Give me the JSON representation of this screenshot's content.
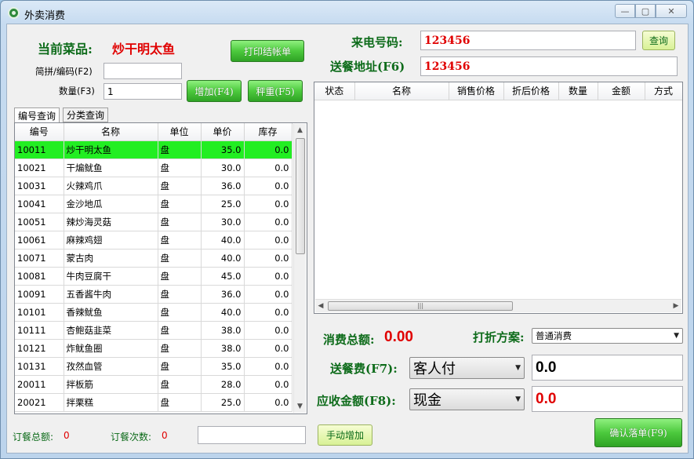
{
  "window": {
    "title": "外卖消费",
    "min": "▭",
    "max": "▢",
    "close": "✕",
    "icon": "app-logo-icon"
  },
  "left": {
    "current_dish_label": "当前菜品:",
    "current_dish_value": "炒干明太鱼",
    "print_button": "打印结帐单",
    "code_label": "简拼/编码(F2)",
    "code_value": "",
    "qty_label": "数量(F3)",
    "qty_value": "1",
    "add_button": "增加(F4)",
    "weigh_button": "秤重(F5)",
    "tabs": [
      "编号查询",
      "分类查询"
    ],
    "columns": [
      "编号",
      "名称",
      "单位",
      "单价",
      "库存"
    ],
    "rows": [
      [
        "10011",
        "炒干明太鱼",
        "盘",
        "35.0",
        "0.0"
      ],
      [
        "10021",
        "干煸鱿鱼",
        "盘",
        "30.0",
        "0.0"
      ],
      [
        "10031",
        "火辣鸡爪",
        "盘",
        "36.0",
        "0.0"
      ],
      [
        "10041",
        "金沙地瓜",
        "盘",
        "25.0",
        "0.0"
      ],
      [
        "10051",
        "辣炒海灵菇",
        "盘",
        "30.0",
        "0.0"
      ],
      [
        "10061",
        "麻辣鸡翅",
        "盘",
        "40.0",
        "0.0"
      ],
      [
        "10071",
        "蒙古肉",
        "盘",
        "40.0",
        "0.0"
      ],
      [
        "10081",
        "牛肉豆腐干",
        "盘",
        "45.0",
        "0.0"
      ],
      [
        "10091",
        "五香酱牛肉",
        "盘",
        "36.0",
        "0.0"
      ],
      [
        "10101",
        "香辣鱿鱼",
        "盘",
        "40.0",
        "0.0"
      ],
      [
        "10111",
        "杏鲍菇韭菜",
        "盘",
        "38.0",
        "0.0"
      ],
      [
        "10121",
        "炸鱿鱼圈",
        "盘",
        "38.0",
        "0.0"
      ],
      [
        "10131",
        "孜然血管",
        "盘",
        "35.0",
        "0.0"
      ],
      [
        "20011",
        "拌板筋",
        "盘",
        "28.0",
        "0.0"
      ],
      [
        "20021",
        "拌栗糕",
        "盘",
        "25.0",
        "0.0"
      ]
    ],
    "total_label": "订餐总额:",
    "total_value": "0",
    "count_label": "订餐次数:",
    "count_value": "0",
    "manual_add_button": "手动增加"
  },
  "right": {
    "phone_label": "来电号码:",
    "phone_value": "123456",
    "query_button": "查询",
    "address_label": "送餐地址(F6)",
    "address_value": "123456",
    "columns": [
      "状态",
      "名称",
      "销售价格",
      "折后价格",
      "数量",
      "金额",
      "方式"
    ],
    "total_label": "消费总额:",
    "total_value": "0.00",
    "discount_label": "打折方案:",
    "discount_value": "普通消费",
    "delivery_label": "送餐费(F7):",
    "delivery_payer": "客人付",
    "delivery_fee": "0.0",
    "receivable_label": "应收金额(F8):",
    "pay_method": "现金",
    "receivable_value": "0.0",
    "confirm_button": "确认落单(F9)"
  },
  "colors": {
    "accent_green": "#22ee22",
    "red_text": "#e00000",
    "label_green": "#0d6b1a"
  }
}
